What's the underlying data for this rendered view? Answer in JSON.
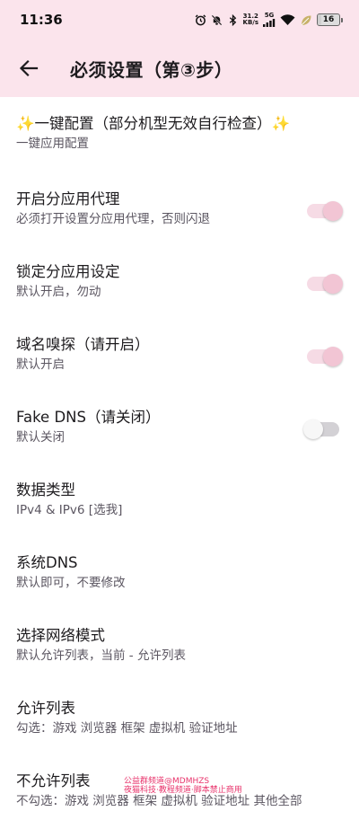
{
  "status_bar": {
    "time": "11:36",
    "net_speed_value": "31.2",
    "net_speed_unit": "KB/s",
    "network_type": "5G",
    "battery_level": "16",
    "battery_percent": 16
  },
  "app_bar": {
    "title": "必须设置（第③步）"
  },
  "items": [
    {
      "title": "✨一键配置（部分机型无效自行检查）✨",
      "subtitle": "一键应用配置"
    },
    {
      "title": "开启分应用代理",
      "subtitle": "必须打开设置分应用代理，否则闪退",
      "switch": "on"
    },
    {
      "title": "锁定分应用设定",
      "subtitle": "默认开启，勿动",
      "switch": "on"
    },
    {
      "title": "域名嗅探（请开启）",
      "subtitle": "默认开启",
      "switch": "on"
    },
    {
      "title": "Fake DNS（请关闭）",
      "subtitle": "默认关闭",
      "switch": "off"
    },
    {
      "title": "数据类型",
      "subtitle": "IPv4 & IPv6 [选我]"
    },
    {
      "title": "系统DNS",
      "subtitle": "默认即可，不要修改"
    },
    {
      "title": "选择网络模式",
      "subtitle": "默认允许列表，当前 -  允许列表"
    },
    {
      "title": "允许列表",
      "subtitle": "勾选：游戏 浏览器 框架 虚拟机 验证地址"
    },
    {
      "title": "不允许列表",
      "subtitle": "不勾选：游戏 浏览器 框架 虚拟机 验证地址 其他全部"
    }
  ],
  "watermark": {
    "line1": "公益群频道@MDMHZS",
    "line2": "夜猫科技·教程频道·脚本禁止商用"
  },
  "colors": {
    "header_bg": "#fbe4ec",
    "switch_on_track": "#f6dbe5",
    "switch_on_knob": "#f2c5d4",
    "switch_off_track": "#d3d1d5",
    "watermark": "#e8336b"
  }
}
